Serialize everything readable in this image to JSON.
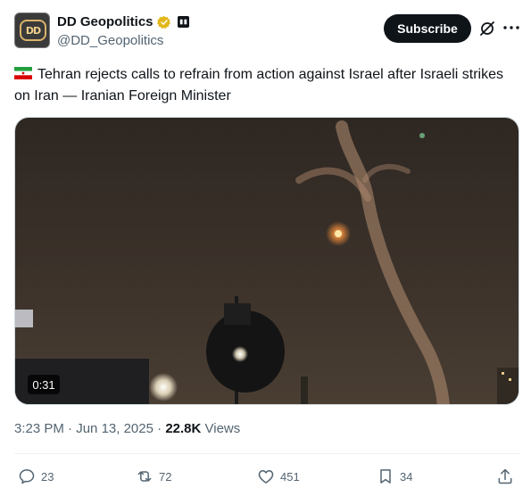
{
  "author": {
    "display_name": "DD Geopolitics",
    "handle": "@DD_Geopolitics",
    "avatar_text": "DD",
    "icons": [
      "verified-badge-icon",
      "affiliate-badge-icon"
    ]
  },
  "header": {
    "subscribe_label": "Subscribe",
    "icons": [
      "grok-icon",
      "more-icon"
    ]
  },
  "tweet": {
    "flag_icon": "iran-flag-icon",
    "text": "Tehran rejects calls to refrain from action against Israel after Israeli strikes on Iran — Iranian Foreign Minister"
  },
  "media": {
    "type": "video",
    "duration": "0:31"
  },
  "meta": {
    "time": "3:23 PM",
    "separator": "·",
    "date": "Jun 13, 2025",
    "views_count": "22.8K",
    "views_label": "Views"
  },
  "actions": {
    "replies": "23",
    "reposts": "72",
    "likes": "451",
    "bookmarks": "34"
  },
  "colors": {
    "primary_text": "#0f1419",
    "secondary_text": "#536471",
    "verified_gold": "#e2b719",
    "subscribe_bg": "#0f1419"
  }
}
